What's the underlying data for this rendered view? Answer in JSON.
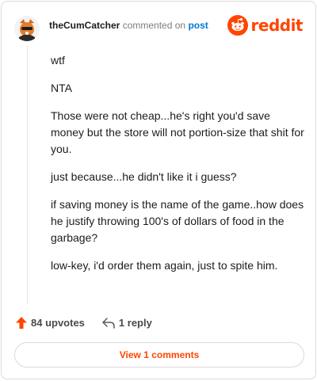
{
  "comment": {
    "username": "theCumCatcher",
    "action_text": "commented on",
    "post_link_text": "post",
    "paragraphs": [
      "wtf",
      "NTA",
      "Those were not cheap...he's right you'd save money but the store will not portion-size that shit for you.",
      "just because...he didn't like it i guess?",
      "if saving money is the name of the game..how does he justify throwing 100's of dollars of food in the garbage?",
      "low-key, i'd order them again, just to spite him."
    ]
  },
  "brand": {
    "wordmark": "reddit",
    "color": "#ff4500"
  },
  "actions": {
    "upvotes_label": "84 upvotes",
    "reply_label": "1 reply"
  },
  "view_comments_label": "View 1 comments",
  "icons": [
    "avatar",
    "reddit-logo-icon",
    "upvote-arrow-icon",
    "reply-icon"
  ]
}
